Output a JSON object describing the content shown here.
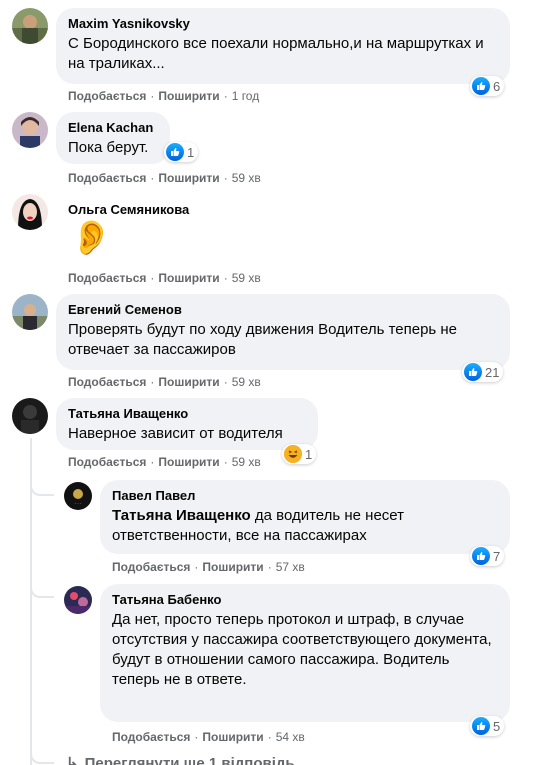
{
  "labels": {
    "like": "Подобається",
    "share": "Поширити"
  },
  "colors": {
    "bubble": "#f0f2f5",
    "meta": "#65676b",
    "like_blue": "#1877f2"
  },
  "comments": [
    {
      "author": "Maxim Yasnikovsky",
      "text": "С Бородинского все поехали нормально,и на маршрутках и на траликах...",
      "time": "1 год",
      "reactions": "6",
      "reaction_icon": "like-icon"
    },
    {
      "author": "Elena Kachan",
      "text": "Пока берут.",
      "time": "59 хв",
      "reactions": "1",
      "reaction_icon": "like-icon"
    },
    {
      "author": "Ольга Семяникова",
      "text": "👂",
      "time": "59 хв"
    },
    {
      "author": "Евгений Семенов",
      "text": "Проверять будут по ходу движения Водитель теперь не отвечает за пассажиров",
      "time": "59 хв",
      "reactions": "21",
      "reaction_icon": "like-icon"
    },
    {
      "author": "Татьяна Иващенко",
      "text": "Наверное зависит от водителя",
      "time": "59 хв",
      "reactions": "1",
      "reaction_icon": "haha-icon"
    }
  ],
  "replies": [
    {
      "author": "Павел Павел",
      "mention": "Татьяна Иващенко",
      "text": "да водитель не несет ответственности, все на пассажирах",
      "time": "57 хв",
      "reactions": "7",
      "reaction_icon": "like-icon"
    },
    {
      "author": "Татьяна Бабенко",
      "text": "Да нет, просто теперь протокол и штраф, в случае отсутствия у пассажира соответствующего документа, будут в отношении самого пассажира. Водитель теперь не в ответе.",
      "time": "54 хв",
      "reactions": "5",
      "reaction_icon": "like-icon"
    }
  ],
  "more_replies": "Переглянути ще 1 відповідь"
}
